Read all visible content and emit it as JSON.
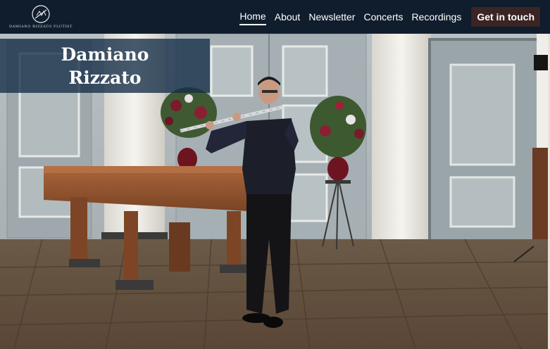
{
  "site": {
    "logo_text": "DAMIANO RIZZATO FLUTIST",
    "logo_icon": "flute-monogram-icon"
  },
  "nav": {
    "items": [
      {
        "label": "Home",
        "active": true
      },
      {
        "label": "About",
        "active": false
      },
      {
        "label": "Newsletter",
        "active": false
      },
      {
        "label": "Concerts",
        "active": false
      },
      {
        "label": "Recordings",
        "active": false
      }
    ],
    "cta_label": "Get in touch"
  },
  "hero": {
    "title_line1": "Damiano",
    "title_line2": "Rizzato",
    "image": "flutist-performing-in-hall-photo"
  },
  "colors": {
    "navbar": "#0f1d2d",
    "cta": "#3a2424",
    "title_overlay": "#142d46"
  }
}
